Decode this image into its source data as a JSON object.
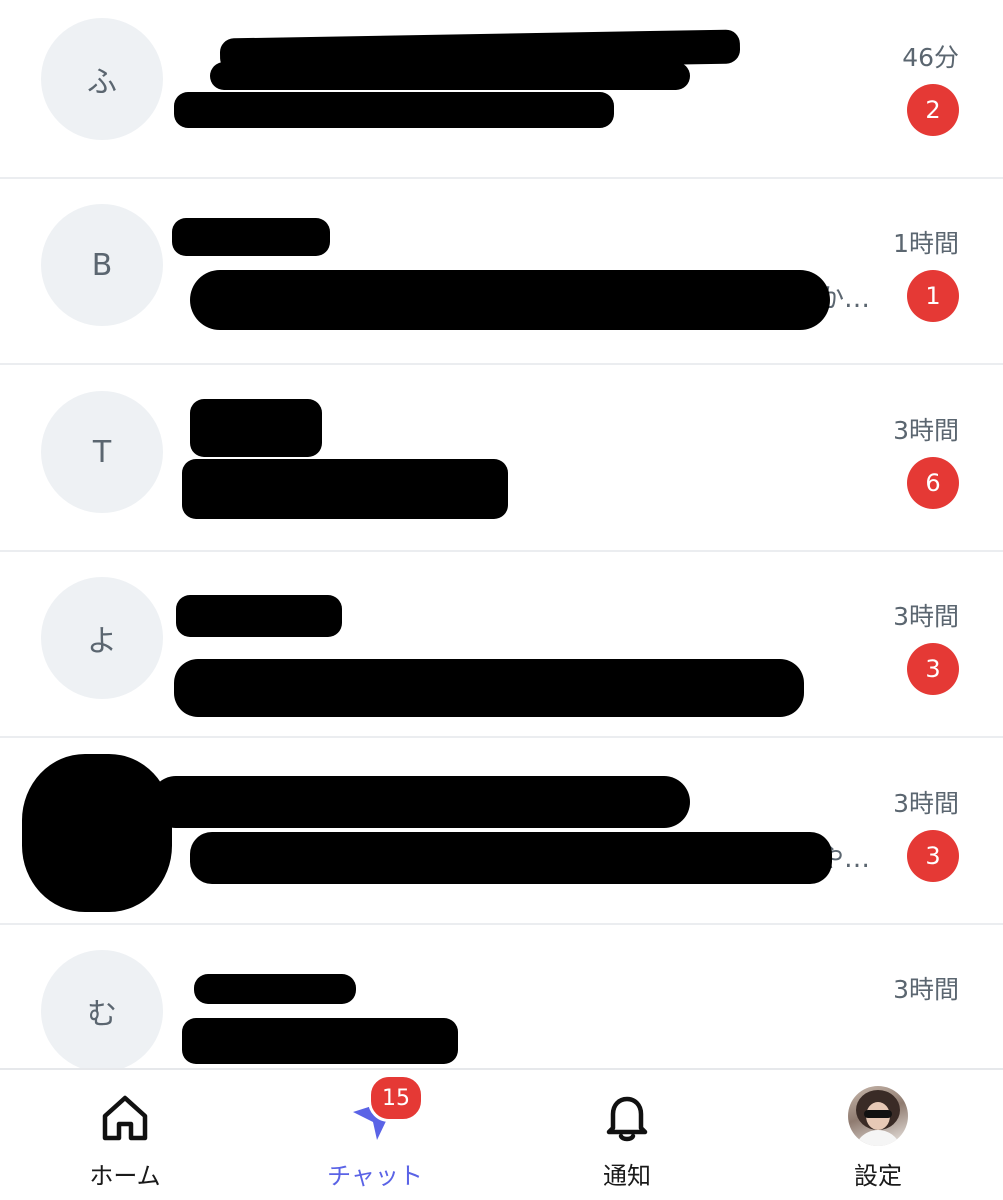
{
  "chats": [
    {
      "avatar_text": "ふ",
      "name": "",
      "preview": "",
      "time": "46分",
      "unread": "2"
    },
    {
      "avatar_text": "B",
      "name": "",
      "preview": "か…",
      "time": "1時間",
      "unread": "1"
    },
    {
      "avatar_text": "T",
      "name": "",
      "preview": "",
      "time": "3時間",
      "unread": "6"
    },
    {
      "avatar_text": "よ",
      "name": "",
      "preview": "",
      "time": "3時間",
      "unread": "3"
    },
    {
      "avatar_text": "",
      "name": "",
      "preview": "や…",
      "time": "3時間",
      "unread": "3"
    },
    {
      "avatar_text": "む",
      "name": "",
      "preview": "",
      "time": "3時間",
      "unread": ""
    }
  ],
  "tabbar": {
    "home": {
      "label": "ホーム",
      "icon": "home-icon"
    },
    "chat": {
      "label": "チャット",
      "icon": "chat-plane-icon",
      "badge": "15"
    },
    "notifications": {
      "label": "通知",
      "icon": "bell-icon"
    },
    "settings": {
      "label": "設定",
      "icon": "profile-avatar"
    }
  },
  "colors": {
    "accent": "#5a63e6",
    "badge": "#e53935",
    "avatar_bg": "#eef1f4"
  }
}
